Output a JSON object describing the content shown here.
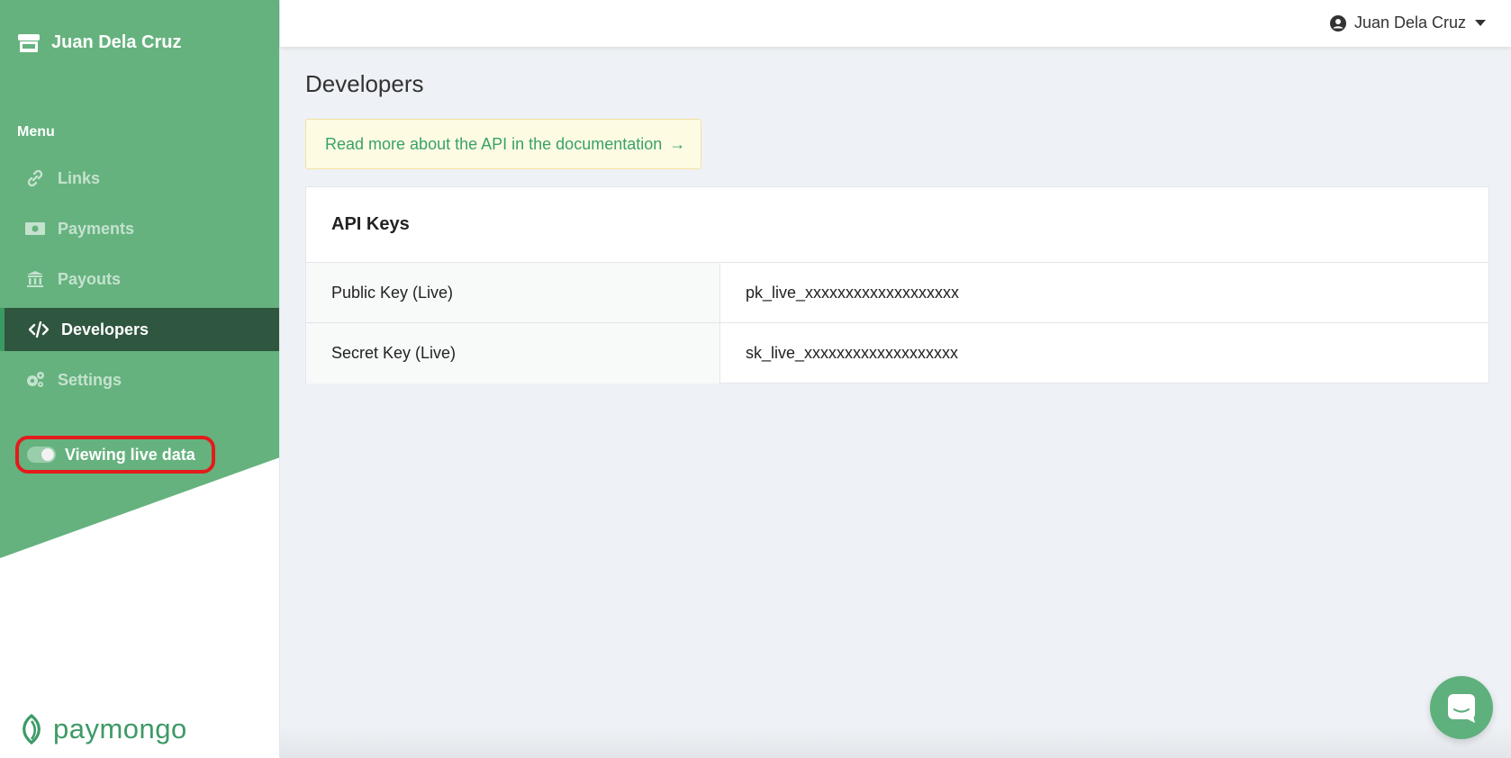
{
  "brand": {
    "name": "Juan Dela Cruz"
  },
  "sidebar": {
    "menu_heading": "Menu",
    "items": [
      {
        "label": "Links",
        "icon": "link-icon"
      },
      {
        "label": "Payments",
        "icon": "money-icon"
      },
      {
        "label": "Payouts",
        "icon": "bank-icon"
      },
      {
        "label": "Developers",
        "icon": "code-icon",
        "active": true
      },
      {
        "label": "Settings",
        "icon": "gears-icon"
      }
    ],
    "toggle": {
      "label": "Viewing live data",
      "on": true
    },
    "logo_text": "paymongo"
  },
  "topbar": {
    "user_name": "Juan Dela Cruz"
  },
  "main": {
    "title": "Developers",
    "doc_banner": {
      "text": "Read more about the API in the documentation",
      "arrow": "→"
    },
    "api_keys": {
      "title": "API Keys",
      "rows": [
        {
          "label": "Public Key (Live)",
          "value": "pk_live_xxxxxxxxxxxxxxxxxxx"
        },
        {
          "label": "Secret Key (Live)",
          "value": "sk_live_xxxxxxxxxxxxxxxxxxx"
        }
      ]
    }
  },
  "colors": {
    "sidebar_green": "#65b27e",
    "active_bg": "#2f563f",
    "accent": "#38a169",
    "highlight_border": "#e31b1b"
  }
}
